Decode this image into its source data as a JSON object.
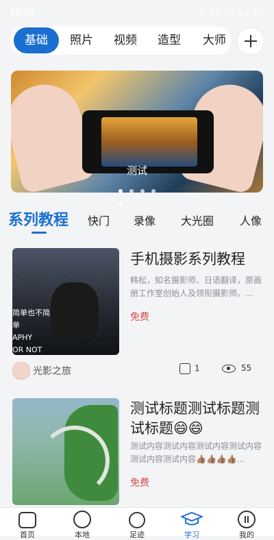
{
  "status_bar": {
    "time": "16:23",
    "right": "令 5G ⓒ 46 73"
  },
  "top_tabs": [
    "基础",
    "照片",
    "视频",
    "造型",
    "大师"
  ],
  "active_top_tab_index": 0,
  "banner": {
    "caption": "测试",
    "dots_total": 5,
    "active_dot_index": 0
  },
  "category_tabs": [
    "系列教程",
    "快门",
    "录像",
    "大光圈",
    "人像"
  ],
  "active_category_index": 0,
  "cards": [
    {
      "title": "手机摄影系列教程",
      "description": "韩松，知名摄影师、日语翻译，原画册工作室创始人及领衔摄影师。...",
      "price": "免费",
      "image_overlay_text": [
        "简单也不简单",
        "APHY",
        "OR NOT"
      ],
      "author": "光影之旅",
      "likes": "1",
      "views": "55"
    },
    {
      "title": "测试标题测试标题测试标题😄😄",
      "description": "测试内容测试内容测试内容测试内容测试内容测试内容👍🏽👍🏽👍🏽👍🏽...",
      "price": "免费"
    }
  ],
  "bottom_nav": [
    {
      "label": "首页",
      "icon": "home-icon"
    },
    {
      "label": "本地",
      "icon": "compass-icon"
    },
    {
      "label": "足迹",
      "icon": "planet-icon"
    },
    {
      "label": "学习",
      "icon": "graduation-cap-icon"
    },
    {
      "label": "我的",
      "icon": "profile-icon"
    }
  ],
  "active_bottom_index": 3,
  "colors": {
    "accent": "#1a6fd1",
    "price": "#d94a4a",
    "background": "#f3f4f6"
  }
}
